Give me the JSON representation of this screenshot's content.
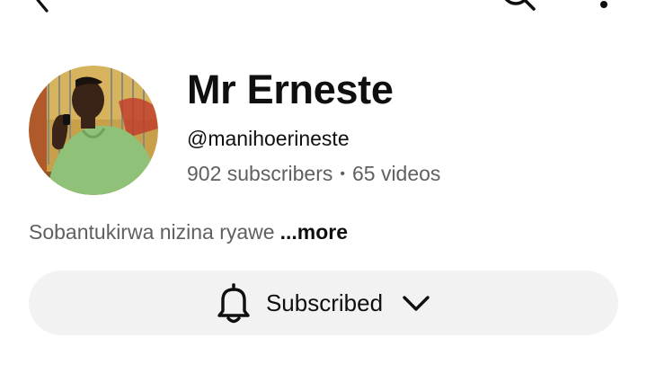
{
  "header": {
    "back_icon": "arrow-back-icon",
    "search_icon": "search-icon",
    "more_icon": "more-vert-icon"
  },
  "channel": {
    "name": "Mr Erneste",
    "handle": "@manihoerineste",
    "subscribers": "902 subscribers",
    "separator": "•",
    "videos": "65 videos",
    "description": "Sobantukirwa nizina ryawe",
    "more_label": "...more"
  },
  "subscribe": {
    "label": "Subscribed",
    "bell_icon": "bell-icon",
    "chevron_icon": "chevron-down-icon",
    "background": "#f2f2f2"
  },
  "colors": {
    "primary_text": "#0f0f0f",
    "secondary_text": "#606060"
  }
}
